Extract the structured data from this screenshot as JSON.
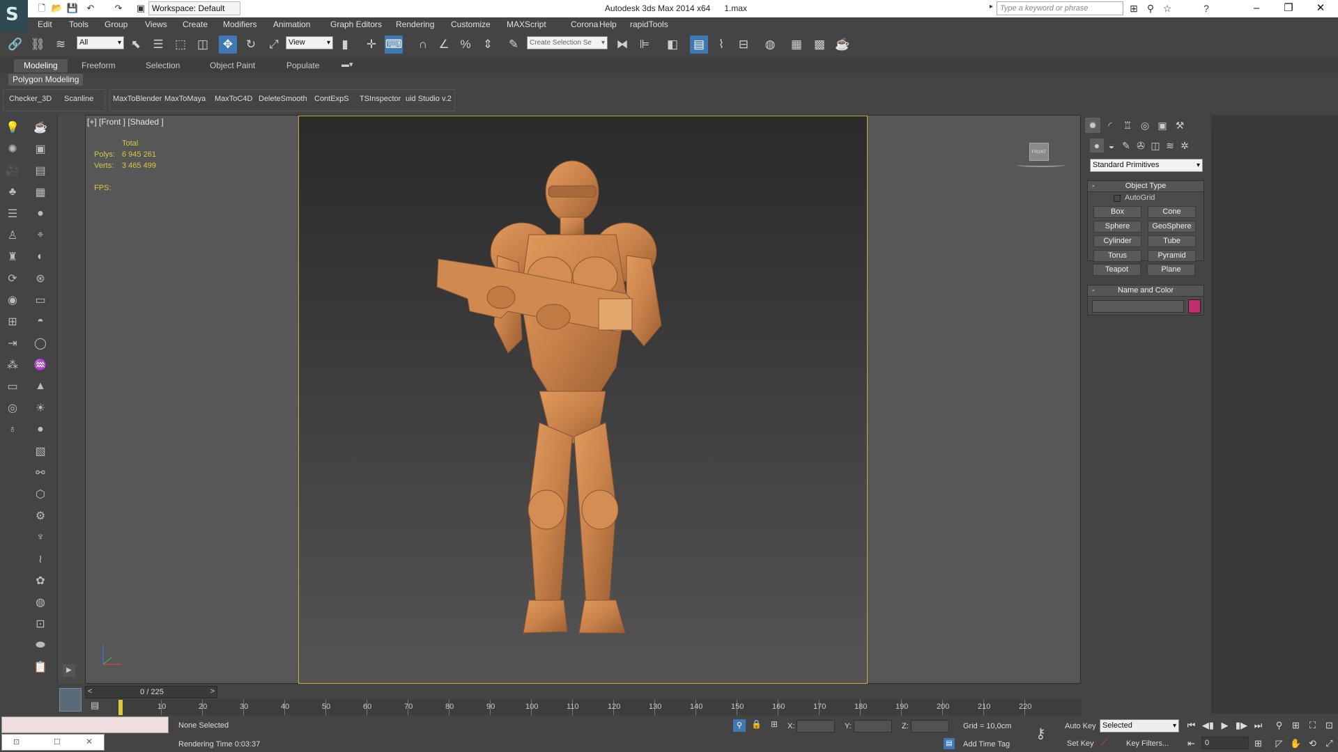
{
  "title": {
    "workspace": "Workspace: Default",
    "app": "Autodesk 3ds Max  2014 x64",
    "file": "1.max",
    "search_placeholder": "Type a keyword or phrase"
  },
  "menu": [
    "Edit",
    "Tools",
    "Group",
    "Views",
    "Create",
    "Modifiers",
    "Animation",
    "Graph Editors",
    "Rendering",
    "Customize",
    "MAXScript",
    "Corona",
    "Help",
    "rapidTools"
  ],
  "toolbar": {
    "filter": "All",
    "ref_coord": "View",
    "selection_set_placeholder": "Create Selection Se"
  },
  "ribbon": {
    "tabs": [
      "Modeling",
      "Freeform",
      "Selection",
      "Object Paint",
      "Populate"
    ],
    "active": "Modeling",
    "panel": "Polygon Modeling"
  },
  "scripts": {
    "group1": [
      "Checker_3D",
      "Scanline"
    ],
    "group2": [
      "MaxToBlender",
      "MaxToMaya",
      "MaxToC4D",
      "DeleteSmooth",
      "ContExpS",
      "TSInspector",
      "uid Studio v.2"
    ]
  },
  "viewport": {
    "label": "[+] [Front ] [Shaded ]",
    "stats_title": "Total",
    "polys_label": "Polys:",
    "polys_value": "6 945 261",
    "verts_label": "Verts:",
    "verts_value": "3 465 499",
    "fps_label": "FPS:",
    "viewcube_label": "FRONT"
  },
  "command_panel": {
    "category": "Standard Primitives",
    "object_type_title": "Object Type",
    "autogrid": "AutoGrid",
    "buttons": [
      "Box",
      "Cone",
      "Sphere",
      "GeoSphere",
      "Cylinder",
      "Tube",
      "Torus",
      "Pyramid",
      "Teapot",
      "Plane"
    ],
    "name_color_title": "Name and Color",
    "object_color": "#c0306e"
  },
  "timeline": {
    "frame": "0 / 225",
    "ticks": [
      "10",
      "20",
      "30",
      "40",
      "50",
      "60",
      "70",
      "80",
      "90",
      "100",
      "110",
      "120",
      "130",
      "140",
      "150",
      "160",
      "170",
      "180",
      "190",
      "200",
      "210",
      "220"
    ]
  },
  "status": {
    "selection": "None Selected",
    "render_time": "Rendering Time  0:03:37",
    "x_label": "X:",
    "y_label": "Y:",
    "z_label": "Z:",
    "grid": "Grid = 10,0cm",
    "add_time_tag": "Add Time Tag",
    "auto_key": "Auto Key",
    "set_key": "Set Key",
    "key_mode": "Selected",
    "key_filters": "Key Filters...",
    "current_frame": "0"
  },
  "colors": {
    "accent": "#3f78b3",
    "viewport_border": "#c8b23c",
    "stats_text": "#d9c843",
    "model": "#c8814a"
  }
}
